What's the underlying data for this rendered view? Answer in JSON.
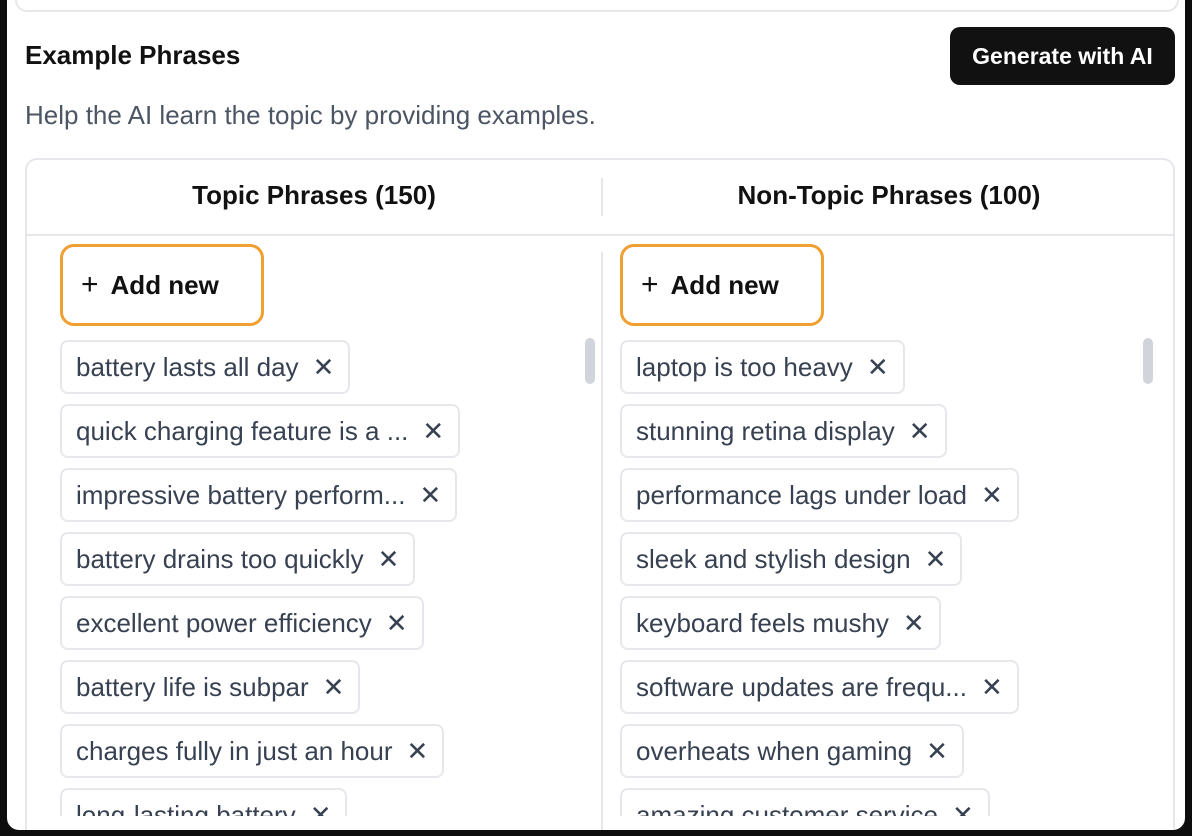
{
  "header": {
    "title": "Example Phrases",
    "generate_label": "Generate with AI",
    "help_text": "Help the AI learn the topic by providing examples."
  },
  "topic": {
    "title": "Topic Phrases (150)",
    "add_label": "Add new",
    "phrases": [
      "battery lasts all day",
      "quick charging feature is a ...",
      "impressive battery perform...",
      "battery drains too quickly",
      "excellent power efficiency",
      "battery life is subpar",
      "charges fully in just an hour",
      "long-lasting battery"
    ]
  },
  "nontopic": {
    "title": "Non-Topic Phrases (100)",
    "add_label": "Add new",
    "phrases": [
      "laptop is too heavy",
      "stunning retina display",
      "performance lags under load",
      "sleek and stylish design",
      "keyboard feels mushy",
      "software updates are frequ...",
      "overheats when gaming",
      "amazing customer service"
    ]
  },
  "icons": {
    "plus": "plus-icon",
    "remove": "close-icon"
  },
  "colors": {
    "add_border": "#f0a030",
    "primary_button": "#111111"
  }
}
